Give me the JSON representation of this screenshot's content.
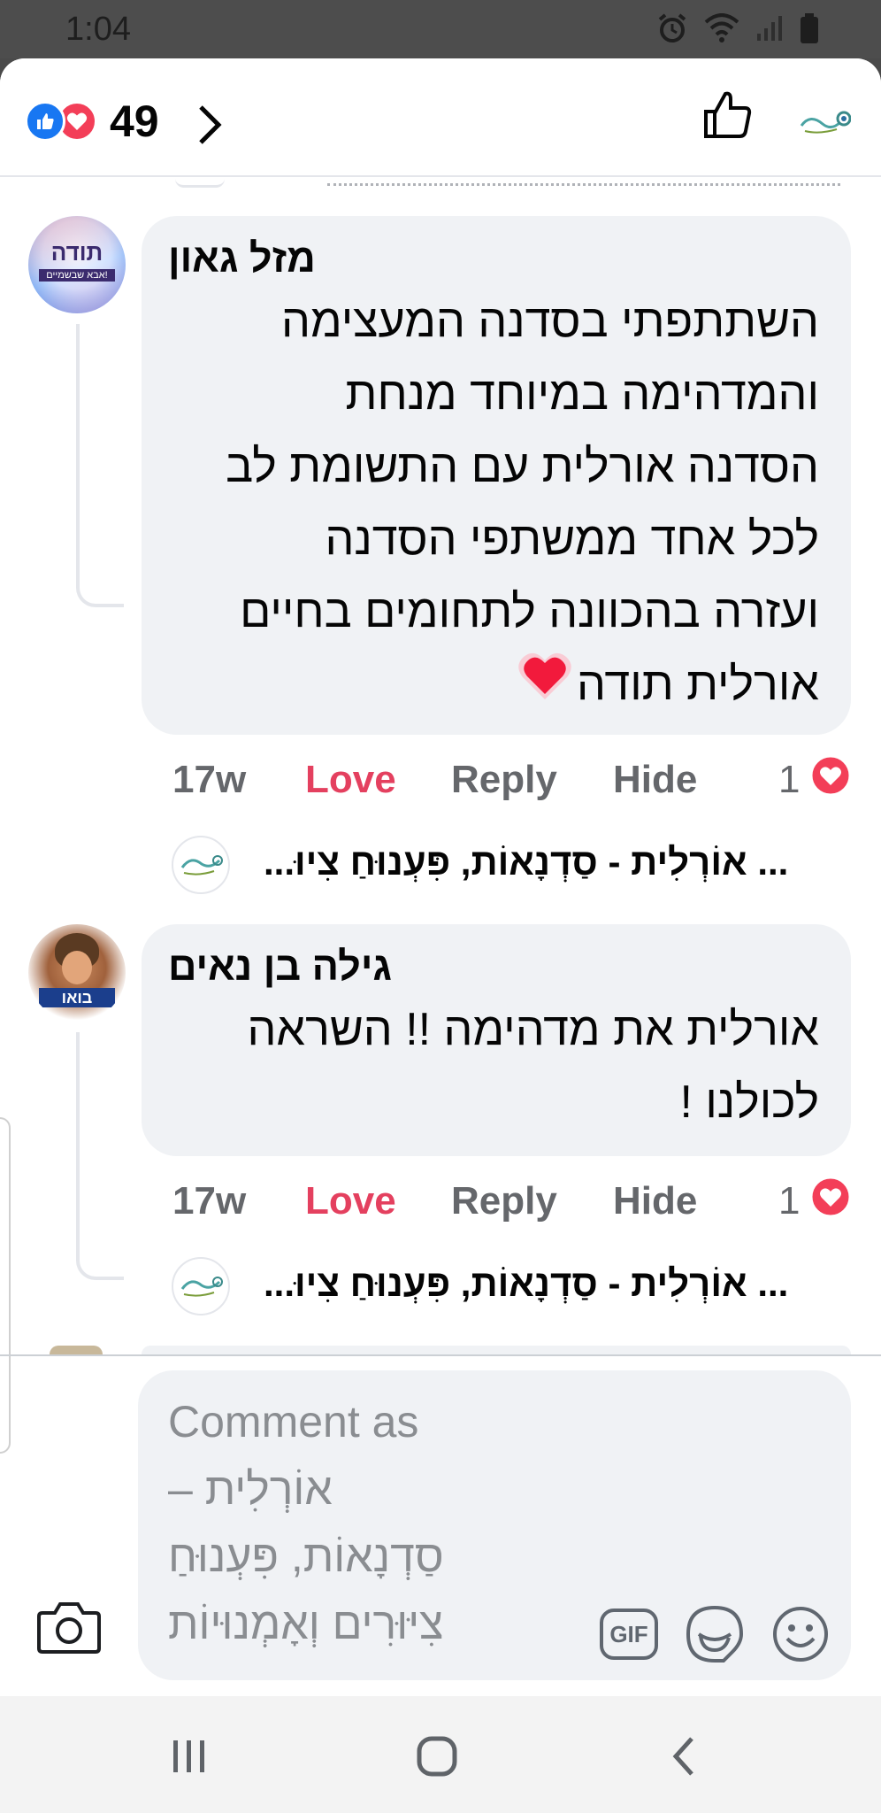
{
  "status_bar": {
    "time": "1:04"
  },
  "header": {
    "reaction_count": "49",
    "reaction_icons": [
      "like-icon",
      "love-icon"
    ]
  },
  "comments": [
    {
      "author": "מזל גאון",
      "avatar_text_line1": "תודה",
      "avatar_text_line2": "אבא שבשמיים!",
      "text_lines": [
        "השתתפתי בסדנה המעצימה",
        "והמדהימה במיוחד מנחת",
        "הסדנה אורלית עם התשומת לב",
        "לכל אחד ממשתפי הסדנה",
        "ועזרה בהכוונה לתחומים בחיים",
        "אורלית תודה"
      ],
      "time": "17w",
      "love_label": "Love",
      "reply_label": "Reply",
      "hide_label": "Hide",
      "reaction_count": "1",
      "reply_preview": "... אוֹרְלִית - סַדְנָאוֹת, פִּעְנוּחַ צִיוּ..."
    },
    {
      "author": "גילה בן נאים",
      "avatar_text": "בואו",
      "text_lines": [
        "אורלית את מדהימה !! השראה",
        "לכולנו !"
      ],
      "time": "17w",
      "love_label": "Love",
      "reply_label": "Reply",
      "hide_label": "Hide",
      "reaction_count": "1",
      "reply_preview": "... אוֹרְלִית - סַדְנָאוֹת, פִּעְנוּחַ צִיוּ..."
    }
  ],
  "composer": {
    "placeholder_lines": [
      "Comment as",
      "אוֹרְלִית –",
      "סַדְנָאוֹת, פִּעְנוּחַ",
      "צִיּוּרִים וְאָמְנוּיוֹת"
    ],
    "gif_label": "GIF"
  },
  "colors": {
    "accent_blue": "#1877f2",
    "love_red": "#f33e58",
    "love_text": "#e4405f",
    "bubble_bg": "#f0f2f5"
  }
}
